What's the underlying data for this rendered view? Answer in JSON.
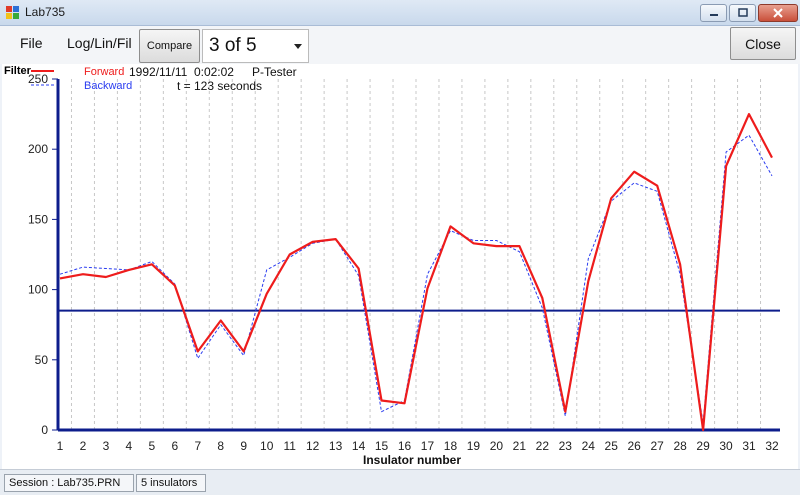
{
  "window": {
    "title": "Lab735"
  },
  "menu": {
    "file": "File",
    "loglin": "Log/Lin/Fil"
  },
  "toolbar": {
    "compare_label": "Compare",
    "selector_value": "3 of 5",
    "close_label": "Close"
  },
  "chart_header": {
    "filter_label": "Filter",
    "datetime": "1992/11/11  0:02:02",
    "tester": "P-Tester",
    "duration": "t = 123 seconds"
  },
  "colors": {
    "forward": "#ee1c1c",
    "backward": "#2a3cf0",
    "threshold": "#0d1d8c",
    "grid": "#c8c8c8"
  },
  "chart_data": {
    "type": "line",
    "xlabel": "Insulator number",
    "ylabel": "",
    "x": [
      1,
      2,
      3,
      4,
      5,
      6,
      7,
      8,
      9,
      10,
      11,
      12,
      13,
      14,
      15,
      16,
      17,
      18,
      19,
      20,
      21,
      22,
      23,
      24,
      25,
      26,
      27,
      28,
      29,
      30,
      31,
      32
    ],
    "xlim": [
      1,
      32
    ],
    "ylim": [
      0,
      250
    ],
    "y_ticks": [
      0,
      50,
      100,
      150,
      200,
      250
    ],
    "grid": "vertical dashed",
    "legend_position": "top-left",
    "threshold": 85,
    "series": [
      {
        "name": "Forward",
        "style": "solid",
        "values": [
          108,
          111,
          109,
          114,
          118,
          103,
          56,
          78,
          56,
          97,
          125,
          134,
          136,
          115,
          21,
          19,
          101,
          145,
          133,
          131,
          131,
          94,
          13,
          106,
          165,
          184,
          174,
          118,
          0,
          188,
          225,
          194
        ]
      },
      {
        "name": "Backward",
        "style": "dashed",
        "values": [
          111,
          116,
          115,
          114,
          120,
          104,
          51,
          75,
          53,
          114,
          123,
          133,
          136,
          110,
          13,
          21,
          111,
          142,
          135,
          135,
          127,
          87,
          10,
          122,
          163,
          176,
          170,
          111,
          5,
          198,
          210,
          181
        ]
      }
    ]
  },
  "status": {
    "session": "Session : Lab735.PRN",
    "count": "5 insulators"
  }
}
